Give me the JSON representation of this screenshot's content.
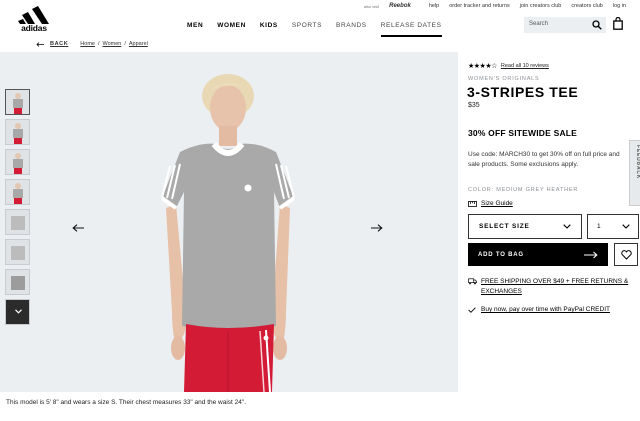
{
  "header": {
    "logo_text": "adidas",
    "also_visit": "also visit",
    "reebok": "Reebok",
    "util_links": [
      "help",
      "order tracker and returns",
      "join creators club",
      "creators club",
      "log in"
    ],
    "nav": [
      "MEN",
      "WOMEN",
      "KIDS",
      "SPORTS",
      "BRANDS",
      "RELEASE DATES"
    ],
    "search_placeholder": "Search"
  },
  "breadcrumb": {
    "back": "BACK",
    "items": [
      "Home",
      "Women",
      "Apparel"
    ]
  },
  "product": {
    "review_link": "Read all 10 reviews",
    "stars_filled": 4,
    "brand_sub": "WOMEN'S ORIGINALS",
    "title": "3-STRIPES TEE",
    "price": "$35",
    "promo_title": "30% OFF SITEWIDE SALE",
    "promo_text": "Use code: MARCH30 to get 30% off on full price and sale products. Some exclusions apply.",
    "color_label": "COLOR: MEDIUM GREY HEATHER",
    "size_guide": "Size Guide",
    "select_size": "SELECT SIZE",
    "quantity": "1",
    "add_to_bag": "ADD TO BAG",
    "shipping": "FREE SHIPPING OVER $49 + FREE RETURNS & EXCHANGES",
    "paypal": "Buy now, pay over time with PayPal CREDIT"
  },
  "gallery": {
    "caption": "This model is 5' 8\" and wears a size S. Their chest measures 33\" and the waist 24\"."
  },
  "feedback_tab": "FEEDBACK",
  "colors": {
    "accent": "#000000",
    "gallery_bg": "#eceff1",
    "legging_red": "#d31b35",
    "tee_grey": "#a9a9a9"
  }
}
